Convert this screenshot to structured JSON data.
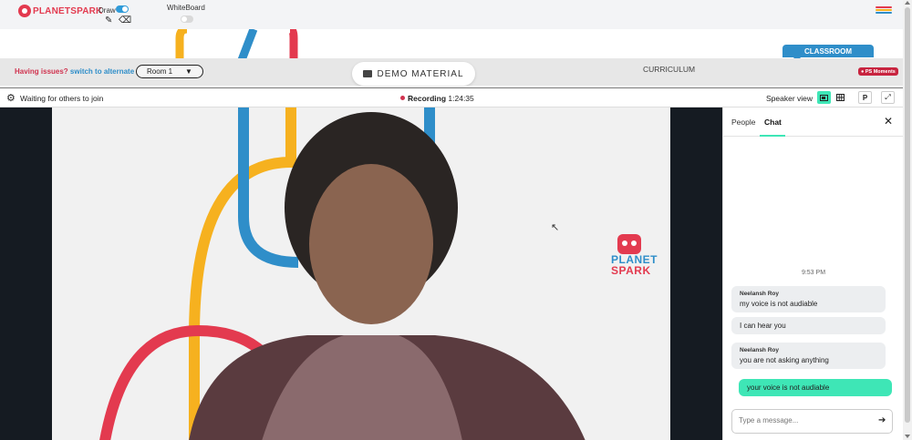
{
  "app": {
    "logo_text": "PLANETSPARK"
  },
  "topbar": {
    "draw_label": "Draw",
    "draw_enabled": true,
    "whiteboard_label": "WhiteBoard",
    "whiteboard_enabled": false,
    "icons": [
      "pencil-icon",
      "eraser-icon",
      "menu-icon"
    ],
    "menu_colors": [
      "#e33a4f",
      "#f6b11f",
      "#2f8ec9"
    ]
  },
  "classbar": {
    "issues_text": "Having issues?",
    "alternate_room_link": "switch to alternate room",
    "room_selected": "Room 1",
    "room_caret": "▼",
    "demo_material_label": "DEMO MATERIAL",
    "curriculum_label": "CURRICULUM",
    "classroom_tab": "CLASSROOM",
    "ps_moments_label": "PS Moments"
  },
  "status": {
    "waiting_text": "Waiting for others to join",
    "recording_label": "Recording",
    "recording_time": "1:24:35",
    "speaker_view_label": "Speaker view",
    "p_button": "P"
  },
  "video": {
    "brand_line1": "PLANET",
    "brand_line2": "SPARK"
  },
  "chat": {
    "tabs": [
      {
        "label": "People",
        "active": false
      },
      {
        "label": "Chat",
        "active": true
      }
    ],
    "time_label": "9:53 PM",
    "messages": [
      {
        "sender": "Neelansh Roy",
        "text": "my voice is not audiable",
        "own": false
      },
      {
        "sender": "",
        "text": "I can hear you",
        "own": false
      },
      {
        "sender": "Neelansh Roy",
        "text": "you are not asking anything",
        "own": false
      },
      {
        "sender": "",
        "text": "your voice is not audiable",
        "own": true
      }
    ],
    "input_placeholder": "Type a message..."
  },
  "colors": {
    "accent_green": "#3ee6b6",
    "brand_red": "#e33a4f",
    "brand_blue": "#2f8ec9",
    "brand_yellow": "#f6b11f"
  }
}
